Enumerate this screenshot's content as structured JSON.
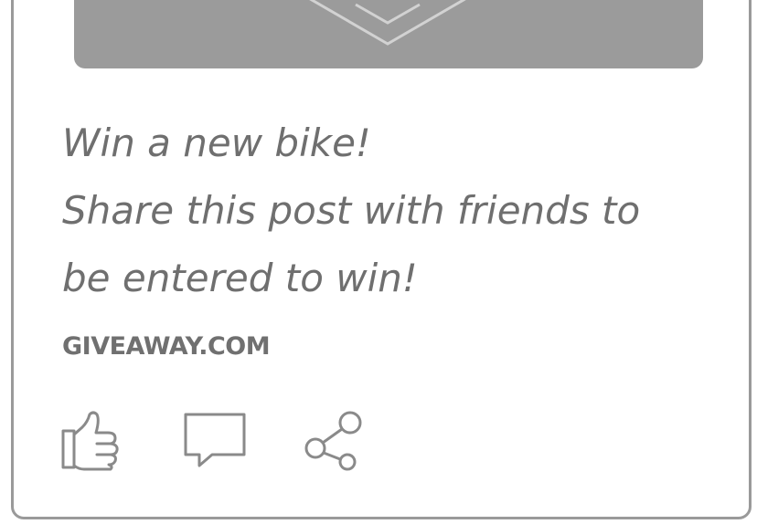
{
  "post": {
    "caption_lines": [
      "Win a new bike!",
      "Share this post with friends to",
      "be entered to win!"
    ],
    "source_link": "GIVEAWAY.COM"
  },
  "actions": {
    "like_icon": "thumbs-up-icon",
    "comment_icon": "speech-bubble-icon",
    "share_icon": "share-icon"
  },
  "colors": {
    "border": "#9a9a9a",
    "media_background": "#9b9b9b",
    "text": "#6f6f6f",
    "icon_stroke": "#8a8a8a"
  }
}
